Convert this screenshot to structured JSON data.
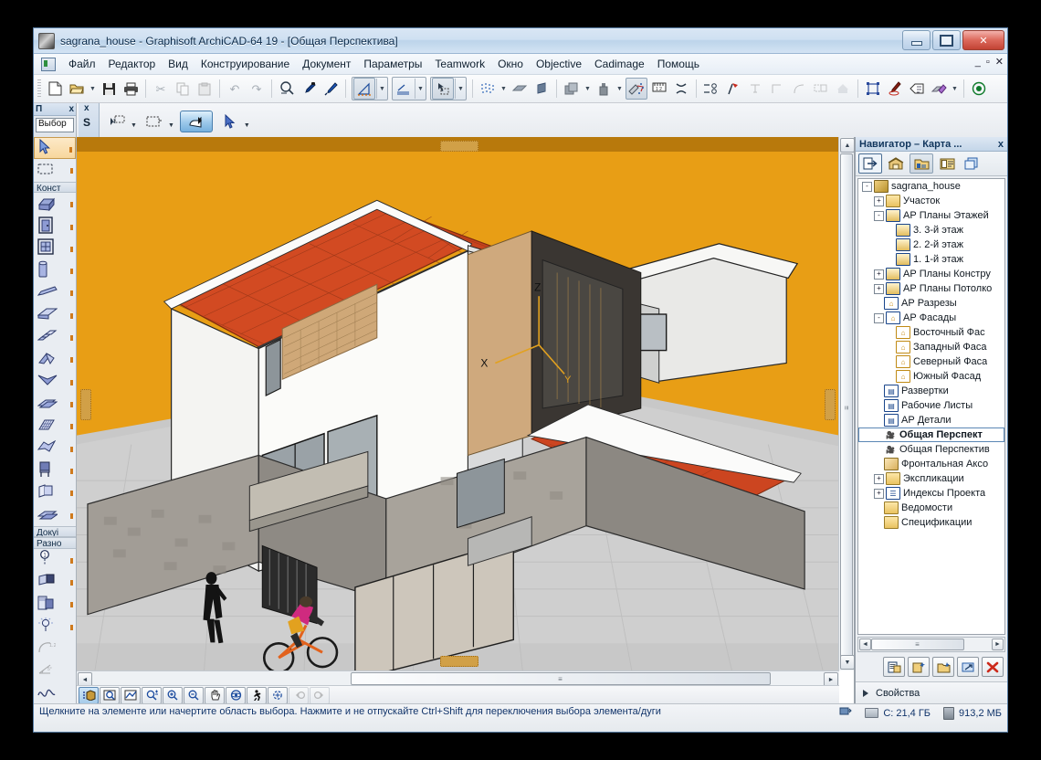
{
  "window": {
    "title": "sagrana_house - Graphisoft ArchiCAD-64 19 - [Общая Перспектива]",
    "icon": "archicad-logo-icon",
    "minimize": "–",
    "maximize": "▫",
    "close": "✕"
  },
  "menubar": {
    "app_icon": "app-menu-icon",
    "items": [
      "Файл",
      "Редактор",
      "Вид",
      "Конструирование",
      "Документ",
      "Параметры",
      "Teamwork",
      "Окно",
      "Objective",
      "Cadimage",
      "Помощь"
    ],
    "window_controls": [
      "_",
      "▫",
      "✕"
    ]
  },
  "toolbar": {
    "groups": [
      {
        "items": [
          {
            "name": "new-document-icon",
            "glyph": "🗋",
            "state": "normal"
          },
          {
            "name": "open-folder-icon",
            "glyph": "🖿",
            "state": "normal",
            "dropdown": true
          },
          {
            "name": "save-icon",
            "glyph": "🖫",
            "state": "normal"
          },
          {
            "name": "print-icon",
            "glyph": "🖨",
            "state": "normal"
          }
        ]
      },
      {
        "items": [
          {
            "name": "cut-scissors-icon",
            "glyph": "✄",
            "state": "disabled"
          },
          {
            "name": "copy-icon",
            "glyph": "⧉",
            "state": "disabled"
          },
          {
            "name": "paste-icon",
            "glyph": "📋",
            "state": "disabled"
          }
        ]
      },
      {
        "items": [
          {
            "name": "undo-icon",
            "glyph": "↶",
            "state": "disabled"
          },
          {
            "name": "redo-icon",
            "glyph": "↷",
            "state": "disabled"
          }
        ]
      },
      {
        "items": [
          {
            "name": "find-select-icon",
            "glyph": "⌕",
            "state": "normal"
          },
          {
            "name": "eyedropper-icon",
            "glyph": "✒",
            "state": "normal"
          },
          {
            "name": "syringe-inject-icon",
            "glyph": "💉",
            "state": "normal"
          }
        ]
      },
      {
        "items": [
          {
            "name": "measure-tool-icon",
            "glyph": "📐",
            "state": "sunk",
            "dropdown": true
          },
          {
            "name": "elevation-dim-icon",
            "glyph": "⤢",
            "state": "normal",
            "dropdown": true
          },
          {
            "name": "marquee-select-icon",
            "glyph": "⬚",
            "state": "normal",
            "dropdown": true
          }
        ]
      },
      {
        "items": [
          {
            "name": "grid-snap-icon",
            "glyph": "⁙",
            "state": "normal",
            "dropdown": true
          },
          {
            "name": "plane-ref-icon",
            "glyph": "▰",
            "state": "normal"
          },
          {
            "name": "mesh-plane-icon",
            "glyph": "▨",
            "state": "normal"
          }
        ]
      },
      {
        "items": [
          {
            "name": "layers-icon",
            "glyph": "❑",
            "state": "normal",
            "dropdown": true
          },
          {
            "name": "pen-weight-icon",
            "glyph": "🖊",
            "state": "normal",
            "dropdown": true
          }
        ]
      },
      {
        "items": [
          {
            "name": "partial-structure-icon",
            "glyph": "🏗",
            "state": "sunk"
          },
          {
            "name": "dimension-1-2-icon",
            "glyph": "⇹",
            "state": "normal"
          },
          {
            "name": "crossing-icon",
            "glyph": "✖",
            "state": "normal"
          }
        ]
      },
      {
        "items": [
          {
            "name": "trim-icon",
            "glyph": "✂",
            "state": "normal"
          },
          {
            "name": "split-axe-icon",
            "glyph": "⚒",
            "state": "normal"
          },
          {
            "name": "adjust-icon",
            "glyph": "⊤",
            "state": "disabled"
          },
          {
            "name": "corner-icon",
            "glyph": "⌐",
            "state": "disabled"
          },
          {
            "name": "fillet-icon",
            "glyph": "◜",
            "state": "disabled"
          },
          {
            "name": "multiply-icon",
            "glyph": "⧈",
            "state": "disabled"
          },
          {
            "name": "solid-element-icon",
            "glyph": "⌂",
            "state": "disabled"
          }
        ]
      },
      {
        "items": [
          {
            "name": "group-icon",
            "glyph": "⊡",
            "state": "normal"
          },
          {
            "name": "pen-marker-icon",
            "glyph": "🖍",
            "state": "normal"
          },
          {
            "name": "label-icon",
            "glyph": "🏷",
            "state": "normal"
          },
          {
            "name": "render-3d-icon",
            "glyph": "◈",
            "state": "normal",
            "dropdown": true
          }
        ]
      },
      {
        "items": [
          {
            "name": "objective-check-icon",
            "glyph": "◉",
            "state": "normal"
          }
        ]
      }
    ]
  },
  "tool_settings_row": {
    "info_panel": {
      "caption": "П",
      "close": "x",
      "field_value": "Выбор"
    },
    "left_tab": {
      "close": "x",
      "letter": "S"
    },
    "buttons": [
      {
        "name": "arrow-select-mode-icon",
        "glyph": "⇾",
        "selected": false
      },
      {
        "name": "marquee-mode-icon",
        "glyph": "⬚",
        "selected": false
      },
      {
        "name": "3d-view-mode-icon",
        "glyph": "◆",
        "selected": true
      },
      {
        "name": "pointer-mode-icon",
        "glyph": "➤",
        "selected": false
      }
    ]
  },
  "left_palette": {
    "sections": [
      {
        "label": "Выбор",
        "tools": [
          {
            "name": "arrow-tool-icon",
            "glyph": "➤",
            "selected": true
          },
          {
            "name": "marquee-tool-icon",
            "glyph": "⬚",
            "selected": false
          }
        ]
      },
      {
        "label": "Конст",
        "tools": [
          {
            "name": "wall-tool-icon",
            "glyph": "▰",
            "selected": false
          },
          {
            "name": "door-tool-icon",
            "glyph": "🚪",
            "selected": false
          },
          {
            "name": "window-tool-icon",
            "glyph": "🪟",
            "selected": false
          },
          {
            "name": "column-tool-icon",
            "glyph": "▮",
            "selected": false
          },
          {
            "name": "beam-tool-icon",
            "glyph": "▱",
            "selected": false
          },
          {
            "name": "slab-tool-icon",
            "glyph": "◣",
            "selected": false
          },
          {
            "name": "stair-tool-icon",
            "glyph": "▤",
            "selected": false
          },
          {
            "name": "roof-tool-icon",
            "glyph": "⌂",
            "selected": false
          },
          {
            "name": "shell-tool-icon",
            "glyph": "⋁",
            "selected": false
          },
          {
            "name": "morph-tool-icon",
            "glyph": "◢",
            "selected": false
          },
          {
            "name": "curtain-wall-tool-icon",
            "glyph": "▦",
            "selected": false
          },
          {
            "name": "mesh-tool-icon",
            "glyph": "◇",
            "selected": false
          },
          {
            "name": "object-tool-icon",
            "glyph": "🪑",
            "selected": false
          },
          {
            "name": "zone-tool-icon",
            "glyph": "▣",
            "selected": false
          },
          {
            "name": "stair-object-tool-icon",
            "glyph": "▧",
            "selected": false
          }
        ]
      },
      {
        "label": "Докуі",
        "tools": []
      },
      {
        "label": "Разно",
        "tools": [
          {
            "name": "zone-stamp-icon",
            "glyph": "①",
            "selected": false
          },
          {
            "name": "fill-tool-icon",
            "glyph": "◧",
            "selected": false
          },
          {
            "name": "figure-tool-icon",
            "glyph": "▨",
            "selected": false
          },
          {
            "name": "light-tool-icon",
            "glyph": "☀",
            "selected": false
          },
          {
            "name": "radial-dim-icon",
            "glyph": "⌒",
            "selected": false
          },
          {
            "name": "angle-dim-icon",
            "glyph": "∠",
            "selected": false
          },
          {
            "name": "spline-tool-icon",
            "glyph": "∿",
            "selected": false
          }
        ]
      }
    ]
  },
  "viewport": {
    "scene_name": "Общая Перспектива",
    "sky_color": "#e89e15",
    "ground_color": "#c9c9c9",
    "roof_color": "#c8401c",
    "wall_color": "#f2f2f0",
    "fence_color": "#9e9a93",
    "axis_labels": [
      "Z",
      "X",
      "Y"
    ],
    "bottom_bar": [
      {
        "name": "3d-navigation-icon",
        "glyph": "🏠",
        "state": "on"
      },
      {
        "name": "zoom-window-icon",
        "glyph": "🔍",
        "state": "normal"
      },
      {
        "name": "fit-in-window-icon",
        "glyph": "⤢",
        "state": "normal"
      },
      {
        "name": "zoom-plusminus-icon",
        "glyph": "⌕",
        "state": "normal"
      },
      {
        "name": "zoom-in-icon",
        "glyph": "⊕",
        "state": "normal"
      },
      {
        "name": "zoom-out-icon",
        "glyph": "⊖",
        "state": "normal"
      },
      {
        "name": "pan-hand-icon",
        "glyph": "✋",
        "state": "normal"
      },
      {
        "name": "orbit-icon",
        "glyph": "◎",
        "state": "normal"
      },
      {
        "name": "walk-explore-icon",
        "glyph": "🚶",
        "state": "normal"
      },
      {
        "name": "fit-selection-icon",
        "glyph": "⊙",
        "state": "normal"
      },
      {
        "name": "prev-zoom-icon",
        "glyph": "◄",
        "state": "disabled"
      },
      {
        "name": "next-zoom-icon",
        "glyph": "►",
        "state": "disabled"
      }
    ],
    "scrollbars": {
      "v_up": "▲",
      "v_down": "▼",
      "h_left": "◄",
      "h_right": "►",
      "thumb_grip": "≡"
    }
  },
  "navigator": {
    "title": "Навигатор – Карта ...",
    "close": "x",
    "toolbar": [
      {
        "name": "navigator-menu-icon",
        "glyph": "⇨",
        "state": "box"
      },
      {
        "name": "project-chooser-icon",
        "glyph": "🏠",
        "state": "normal"
      },
      {
        "name": "project-map-icon",
        "glyph": "🗂",
        "state": "sunk"
      },
      {
        "name": "view-map-icon",
        "glyph": "▤",
        "state": "normal"
      },
      {
        "name": "layout-book-icon",
        "glyph": "❐",
        "state": "normal"
      }
    ],
    "tree": [
      {
        "depth": 0,
        "expander": "-",
        "icon": "ic-proj",
        "icon_name": "project-icon",
        "label": "sagrana_house",
        "selected": false
      },
      {
        "depth": 1,
        "expander": "+",
        "icon": "ic-fold",
        "icon_name": "folder-icon",
        "label": "Участок",
        "selected": false
      },
      {
        "depth": 1,
        "expander": "-",
        "icon": "ic-plan",
        "icon_name": "story-folder-icon",
        "label": "АР Планы Этажей",
        "selected": false
      },
      {
        "depth": 2,
        "expander": "",
        "icon": "ic-plan",
        "icon_name": "floor-plan-icon",
        "label": "3. 3-й этаж",
        "selected": false
      },
      {
        "depth": 2,
        "expander": "",
        "icon": "ic-plan",
        "icon_name": "floor-plan-icon",
        "label": "2. 2-й этаж",
        "selected": false
      },
      {
        "depth": 2,
        "expander": "",
        "icon": "ic-plan",
        "icon_name": "floor-plan-icon",
        "label": "1. 1-й этаж",
        "selected": false
      },
      {
        "depth": 1,
        "expander": "+",
        "icon": "ic-plan",
        "icon_name": "construction-plan-folder-icon",
        "label": "АР Планы Констру",
        "selected": false
      },
      {
        "depth": 1,
        "expander": "+",
        "icon": "ic-plan",
        "icon_name": "ceiling-plan-folder-icon",
        "label": "АР Планы Потолко",
        "selected": false
      },
      {
        "depth": 1,
        "expander": "",
        "icon": "ic-sect",
        "icon_name": "section-icon",
        "label": "АР Разрезы",
        "selected": false
      },
      {
        "depth": 1,
        "expander": "-",
        "icon": "ic-sect",
        "icon_name": "elevation-folder-icon",
        "label": "АР Фасады",
        "selected": false
      },
      {
        "depth": 2,
        "expander": "",
        "icon": "ic-elev",
        "icon_name": "elevation-icon",
        "label": "Восточный Фас",
        "selected": false
      },
      {
        "depth": 2,
        "expander": "",
        "icon": "ic-elev",
        "icon_name": "elevation-icon",
        "label": "Западный Фаса",
        "selected": false
      },
      {
        "depth": 2,
        "expander": "",
        "icon": "ic-elev",
        "icon_name": "elevation-icon",
        "label": "Северный Фаса",
        "selected": false
      },
      {
        "depth": 2,
        "expander": "",
        "icon": "ic-elev",
        "icon_name": "elevation-icon",
        "label": "Южный Фасад",
        "selected": false
      },
      {
        "depth": 1,
        "expander": "",
        "icon": "ic-wk",
        "icon_name": "interior-elevation-icon",
        "label": "Развертки",
        "selected": false
      },
      {
        "depth": 1,
        "expander": "",
        "icon": "ic-wk",
        "icon_name": "worksheet-icon",
        "label": "Рабочие Листы",
        "selected": false
      },
      {
        "depth": 1,
        "expander": "",
        "icon": "ic-wk",
        "icon_name": "detail-icon",
        "label": "АР Детали",
        "selected": false
      },
      {
        "depth": 1,
        "expander": "",
        "icon": "ic-cam",
        "icon_name": "camera-perspective-icon",
        "label": "Общая Перспект",
        "selected": true
      },
      {
        "depth": 1,
        "expander": "",
        "icon": "ic-cam",
        "icon_name": "camera-perspective-icon",
        "label": "Общая Перспектив",
        "selected": false
      },
      {
        "depth": 1,
        "expander": "",
        "icon": "ic-axo",
        "icon_name": "axonometry-icon",
        "label": "Фронтальная Аксо",
        "selected": false
      },
      {
        "depth": 1,
        "expander": "+",
        "icon": "ic-fold",
        "icon_name": "folder-icon",
        "label": "Экспликации",
        "selected": false
      },
      {
        "depth": 1,
        "expander": "+",
        "icon": "ic-idx",
        "icon_name": "project-index-icon",
        "label": "Индексы Проекта",
        "selected": false
      },
      {
        "depth": 1,
        "expander": "",
        "icon": "ic-fold",
        "icon_name": "folder-icon",
        "label": "Ведомости",
        "selected": false
      },
      {
        "depth": 1,
        "expander": "",
        "icon": "ic-fold",
        "icon_name": "folder-icon",
        "label": "Спецификации",
        "selected": false
      }
    ],
    "bottom_buttons": [
      {
        "name": "settings-viewpoint-button",
        "glyph": "▤"
      },
      {
        "name": "new-viewpoint-button",
        "glyph": "🗋"
      },
      {
        "name": "new-folder-button",
        "glyph": "🗀"
      },
      {
        "name": "open-viewpoint-button",
        "glyph": "➚"
      },
      {
        "name": "delete-button",
        "glyph": "✕"
      }
    ],
    "properties_label": "Свойства"
  },
  "statusbar": {
    "hint": "Щелкните на элементе или начертите область выбора. Нажмите и не отпускайте Ctrl+Shift для переключения выбора элемента/дуги",
    "hint_icon": "pointer-hint-icon",
    "disk": "C: 21,4 ГБ",
    "memory": "913,2 МБ"
  }
}
